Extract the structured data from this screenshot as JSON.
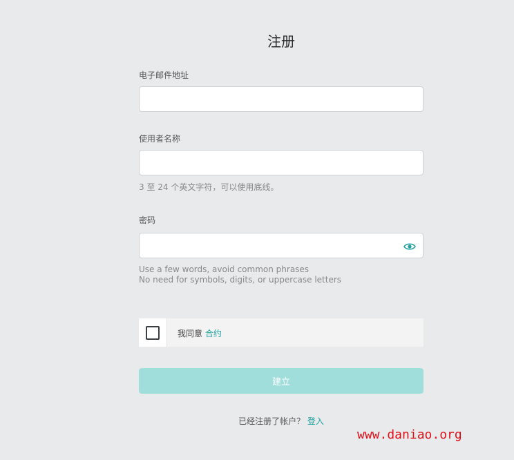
{
  "header": {
    "title": "注册"
  },
  "form": {
    "email": {
      "label": "电子邮件地址",
      "value": "",
      "placeholder": ""
    },
    "username": {
      "label": "使用者名称",
      "value": "",
      "placeholder": "",
      "hint": "3 至 24 个英文字符，可以使用底线。"
    },
    "password": {
      "label": "密码",
      "value": "",
      "placeholder": "",
      "hint_line1": "Use a few words, avoid common phrases",
      "hint_line2": "No need for symbols, digits, or uppercase letters",
      "toggle_icon": "eye-icon"
    },
    "agree": {
      "text": "我同意",
      "link": "合约",
      "checked": false
    },
    "submit_label": "建立",
    "footer": {
      "text": "已经注册了帐户？",
      "link": "登入"
    }
  },
  "colors": {
    "accent": "#23a0a0",
    "button_disabled": "#a0dedb",
    "background": "#e8eaec",
    "watermark": "#e0101a"
  },
  "watermark": {
    "text": "www.daniao.org"
  }
}
